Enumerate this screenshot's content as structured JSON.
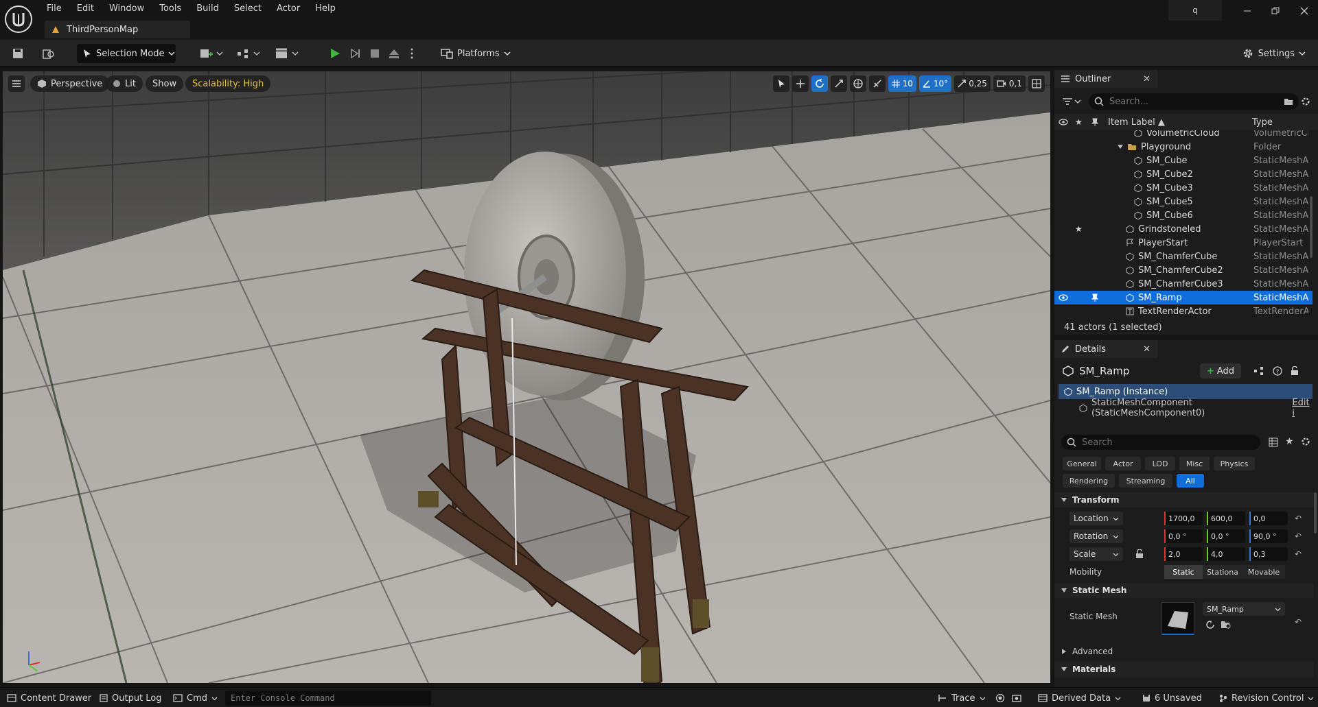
{
  "menu": [
    "File",
    "Edit",
    "Window",
    "Tools",
    "Build",
    "Select",
    "Actor",
    "Help"
  ],
  "level_tab": "ThirdPersonMap",
  "title_search": "q",
  "toolbar": {
    "selection_mode": "Selection Mode",
    "platforms": "Platforms",
    "settings": "Settings"
  },
  "viewport": {
    "perspective": "Perspective",
    "lit": "Lit",
    "show": "Show",
    "scalability": "Scalability: High",
    "grid_snap": "10",
    "rotation_snap": "10°",
    "scale_snap": "0,25",
    "camera_speed": "0,1"
  },
  "outliner": {
    "tab": "Outliner",
    "search_placeholder": "Search...",
    "col_label": "Item Label ▲",
    "col_type": "Type",
    "rows": [
      {
        "label": "VolumetricCloud",
        "type": "VolumetricCl"
      },
      {
        "label": "Playground",
        "type": "Folder"
      },
      {
        "label": "SM_Cube",
        "type": "StaticMeshA"
      },
      {
        "label": "SM_Cube2",
        "type": "StaticMeshA"
      },
      {
        "label": "SM_Cube3",
        "type": "StaticMeshA"
      },
      {
        "label": "SM_Cube5",
        "type": "StaticMeshA"
      },
      {
        "label": "SM_Cube6",
        "type": "StaticMeshA"
      },
      {
        "label": "Grindstoneled",
        "type": "StaticMeshA"
      },
      {
        "label": "PlayerStart",
        "type": "PlayerStart"
      },
      {
        "label": "SM_ChamferCube",
        "type": "StaticMeshA"
      },
      {
        "label": "SM_ChamferCube2",
        "type": "StaticMeshA"
      },
      {
        "label": "SM_ChamferCube3",
        "type": "StaticMeshA"
      },
      {
        "label": "SM_Ramp",
        "type": "StaticMeshA"
      },
      {
        "label": "TextRenderActor",
        "type": "TextRenderA"
      }
    ],
    "footer": "41 actors (1 selected)"
  },
  "details": {
    "tab": "Details",
    "actor_name": "SM_Ramp",
    "add_label": "Add",
    "instance_row": "SM_Ramp (Instance)",
    "component_row": "StaticMeshComponent (StaticMeshComponent0)",
    "component_edit": "Edit i",
    "search_placeholder": "Search",
    "categories_row1": [
      "General",
      "Actor",
      "LOD",
      "Misc",
      "Physics"
    ],
    "categories_row2": [
      "Rendering",
      "Streaming",
      "All"
    ],
    "transform_header": "Transform",
    "location_label": "Location",
    "location": [
      "1700,0",
      "600,0",
      "0,0"
    ],
    "rotation_label": "Rotation",
    "rotation": [
      "0,0 °",
      "0,0 °",
      "90,0 °"
    ],
    "scale_label": "Scale",
    "scale": [
      "2,0",
      "4,0",
      "0,3"
    ],
    "mobility_label": "Mobility",
    "mobility_options": [
      "Static",
      "Stationa",
      "Movable"
    ],
    "static_mesh_header": "Static Mesh",
    "static_mesh_label": "Static Mesh",
    "static_mesh_value": "SM_Ramp",
    "advanced_header": "Advanced",
    "materials_header": "Materials"
  },
  "statusbar": {
    "content_drawer": "Content Drawer",
    "output_log": "Output Log",
    "cmd": "Cmd",
    "console_placeholder": "Enter Console Command",
    "trace": "Trace",
    "derived_data": "Derived Data",
    "unsaved": "6 Unsaved",
    "revision_control": "Revision Control"
  },
  "colors": {
    "accent": "#0f6ddc",
    "play_green": "#3fb53f",
    "scalability_yellow": "#e8c547"
  }
}
